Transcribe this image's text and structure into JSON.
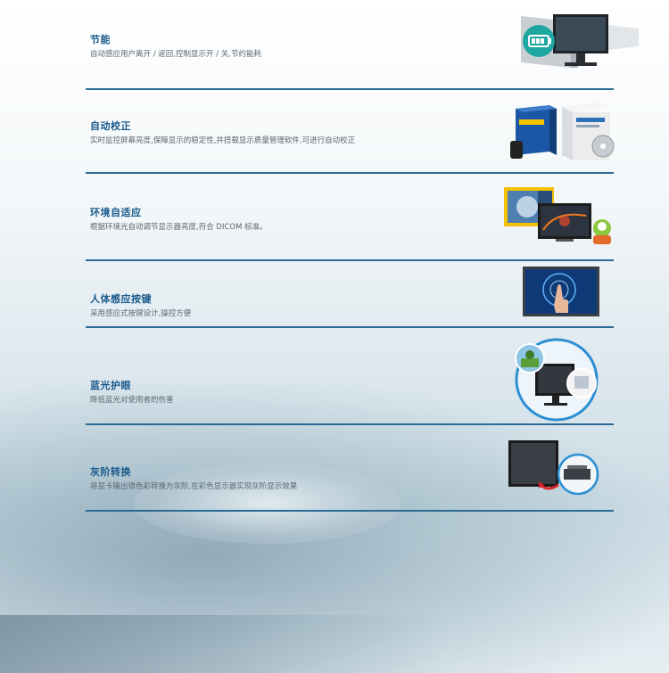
{
  "features": [
    {
      "title": "节能",
      "desc": "自动感应用户离开 / 返回,控制显示开 / 关,节约能耗",
      "image": "energy-saving-monitor-icon"
    },
    {
      "title": "自动校正",
      "desc": "实时监控屏幕亮度,保障显示的稳定性,并搭载显示质量管理软件,可进行自动校正",
      "image": "calibration-software-box-icon"
    },
    {
      "title": "环境自适应",
      "desc": "根据环境光自动调节显示器亮度,符合 DICOM 标准。",
      "image": "ambient-light-sensor-icon"
    },
    {
      "title": "人体感应按键",
      "desc": "采用感应式按键设计,操控方便",
      "image": "touch-sensor-button-icon"
    },
    {
      "title": "蓝光护眼",
      "desc": "降低蓝光对使用者的伤害",
      "image": "blue-light-eye-care-icon"
    },
    {
      "title": "灰阶转换",
      "desc": "将显卡输出得色彩转换为灰阶,在彩色显示器实现灰阶显示效果",
      "image": "grayscale-conversion-icon"
    }
  ]
}
